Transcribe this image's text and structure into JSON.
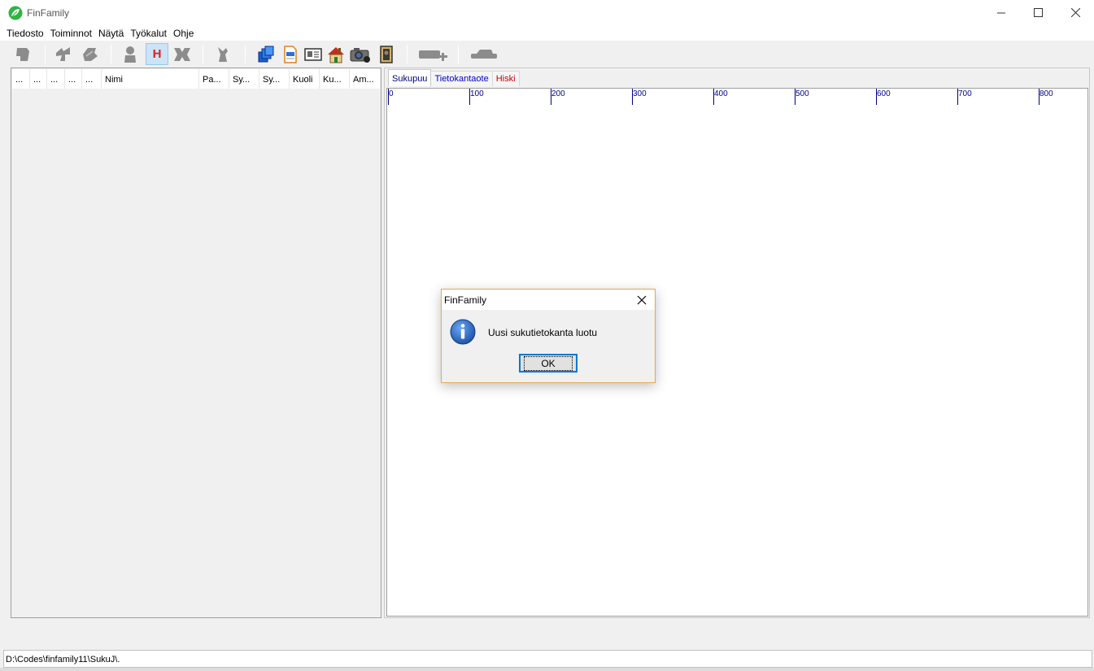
{
  "window": {
    "title": "FinFamily",
    "icon": "finfamily-leaf-icon"
  },
  "menu": {
    "items": [
      "Tiedosto",
      "Toiminnot",
      "Näytä",
      "Työkalut",
      "Ohje"
    ]
  },
  "toolbar": {
    "h_label": "H",
    "icons": [
      "person-icon",
      "relatives-icon",
      "family-icon",
      "person-silhouette-icon",
      "h-icon",
      "couple-icon",
      "child-icon",
      "copy-icon",
      "report-icon",
      "id-card-icon",
      "house-icon",
      "camera-icon",
      "portrait-icon",
      "add-link-icon",
      "remove-link-icon"
    ]
  },
  "table": {
    "columns": [
      "...",
      "...",
      "...",
      "...",
      "...",
      "Nimi",
      "Pa...",
      "Sy...",
      "Sy...",
      "Kuoli",
      "Ku...",
      "Am..."
    ]
  },
  "tabs": [
    {
      "label": "Sukupuu",
      "color": "#000080"
    },
    {
      "label": "Tietokantaote",
      "color": "#0000cc"
    },
    {
      "label": "Hiski",
      "color": "#cc0000"
    }
  ],
  "ruler": {
    "labels": [
      "0",
      "100",
      "200",
      "300",
      "400",
      "500",
      "600",
      "700",
      "800"
    ]
  },
  "status": {
    "path": "D:\\Codes\\finfamily11\\SukuJ\\."
  },
  "dialog": {
    "title": "FinFamily",
    "message": "Uusi sukutietokanta luotu",
    "ok_label": "OK",
    "icon": "info-icon"
  }
}
